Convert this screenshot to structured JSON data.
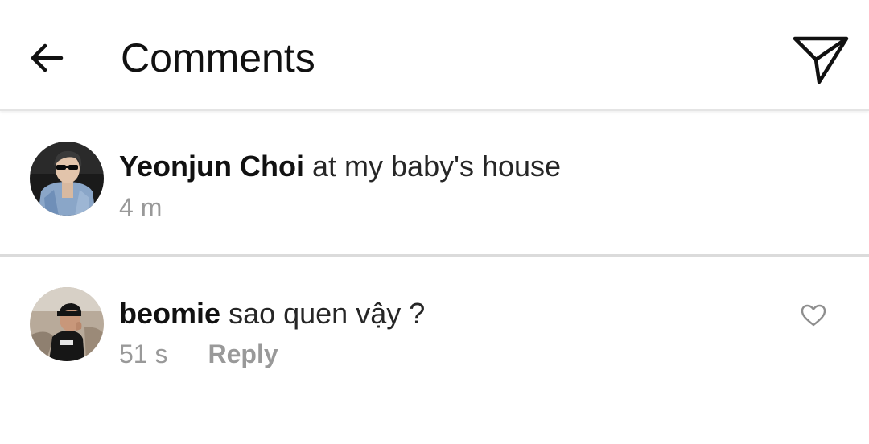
{
  "header": {
    "title": "Comments",
    "back_icon": "arrow-left-icon",
    "share_icon": "paper-plane-icon"
  },
  "caption": {
    "username": "Yeonjun Choi",
    "text": "at my baby's house",
    "time": "4 m"
  },
  "comments": [
    {
      "username": "beomie",
      "text": "sao quen vậy ?",
      "time": "51 s",
      "reply_label": "Reply",
      "like_icon": "heart-outline-icon"
    }
  ],
  "colors": {
    "text_primary": "#262626",
    "text_secondary": "#999999",
    "divider": "#dbdbdb",
    "background": "#ffffff"
  }
}
